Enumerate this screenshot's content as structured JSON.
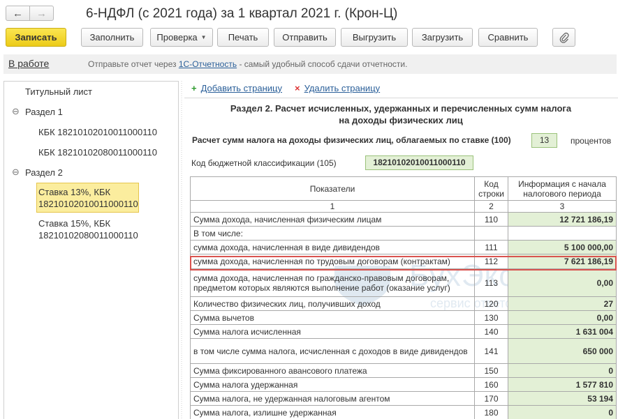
{
  "window": {
    "title": "6-НДФЛ (с 2021 года) за 1 квартал 2021 г. (Крон-Ц)",
    "back_icon": "arrow-left-icon",
    "forward_icon": "arrow-right-icon"
  },
  "toolbar": {
    "save": "Записать",
    "fill": "Заполнить",
    "check": "Проверка",
    "print": "Печать",
    "send": "Отправить",
    "export": "Выгрузить",
    "import": "Загрузить",
    "compare": "Сравнить",
    "attach_icon": "paperclip-icon"
  },
  "infobar": {
    "status": "В работе",
    "text_before": "Отправьте отчет через",
    "link": "1С-Отчетность",
    "text_after": "- самый удобный способ сдачи отчетности."
  },
  "tree": {
    "title_page": "Титульный лист",
    "section1": "Раздел 1",
    "s1_kbk1": "КБК 18210102010011000110",
    "s1_kbk2": "КБК 18210102080011000110",
    "section2": "Раздел 2",
    "s2_item1_line1": "Ставка 13%, КБК",
    "s2_item1_line2": "18210102010011000110",
    "s2_item2_line1": "Ставка 15%, КБК",
    "s2_item2_line2": "18210102080011000110"
  },
  "page_actions": {
    "add": "Добавить страницу",
    "delete": "Удалить страницу"
  },
  "form": {
    "section_title_line1": "Раздел 2. Расчет исчисленных, удержанных и перечисленных сумм налога",
    "section_title_line2": "на доходы физических лиц",
    "rate_label": "Расчет сумм налога на доходы физических лиц, облагаемых по ставке  (100)",
    "rate_value": "13",
    "rate_unit": "процентов",
    "kbk_label": "Код бюджетной классификации  (105)",
    "kbk_value": "18210102010011000110"
  },
  "table": {
    "headers": {
      "indicator": "Показатели",
      "code_line1": "Код",
      "code_line2": "строки",
      "info_line1": "Информация с начала",
      "info_line2": "налогового периода"
    },
    "col_numbers": [
      "1",
      "2",
      "3"
    ],
    "rows": [
      {
        "label": "Сумма дохода, начисленная физическим лицам",
        "code": "110",
        "value": "12 721 186,19"
      },
      {
        "label": "В том числе:",
        "code": "",
        "value": ""
      },
      {
        "label": "сумма дохода, начисленная в виде дивидендов",
        "code": "111",
        "value": "5 100 000,00"
      },
      {
        "label": "сумма дохода, начисленная по трудовым договорам (контрактам)",
        "code": "112",
        "value": "7 621 186,19"
      },
      {
        "label": "сумма дохода, начисленная по гражданско-правовым договорам, предметом которых являются выполнение работ (оказание услуг)",
        "code": "113",
        "value": "0,00"
      },
      {
        "label": "Количество физических лиц, получивших доход",
        "code": "120",
        "value": "27"
      },
      {
        "label": "Сумма вычетов",
        "code": "130",
        "value": "0,00"
      },
      {
        "label": "Сумма налога исчисленная",
        "code": "140",
        "value": "1 631 004"
      },
      {
        "label": "в том числе сумма налога, исчисленная с доходов в виде дивидендов",
        "code": "141",
        "value": "650 000"
      },
      {
        "label": "Сумма фиксированного авансового платежа",
        "code": "150",
        "value": "0"
      },
      {
        "label": "Сумма налога удержанная",
        "code": "160",
        "value": "1 577 810"
      },
      {
        "label": "Сумма налога, не удержанная налоговым агентом",
        "code": "170",
        "value": "53 194"
      },
      {
        "label": "Сумма налога, излишне удержанная",
        "code": "180",
        "value": "0"
      }
    ]
  },
  "watermark": {
    "text": "БухЭксперт",
    "digit": "8",
    "subtitle": "сервис ответов по учету в 1С"
  }
}
